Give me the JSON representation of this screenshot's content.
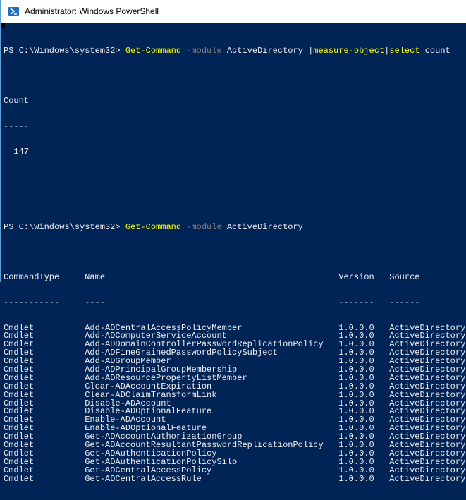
{
  "window": {
    "title": "Administrator: Windows PowerShell"
  },
  "console": {
    "cmd1": {
      "prompt": "PS C:\\Windows\\system32> ",
      "cmd": "Get-Command",
      "param": " -module",
      "arg": " ActiveDirectory ",
      "pipe1": "|",
      "cmd2": "measure-object",
      "pipe2": "|",
      "cmd3": "select",
      "arg2": " count"
    },
    "result1": {
      "header": "Count",
      "dash": "-----",
      "value": "  147"
    },
    "cmd2": {
      "prompt": "PS C:\\Windows\\system32> ",
      "cmd": "Get-Command",
      "param": " -module",
      "arg": " ActiveDirectory"
    },
    "table": {
      "headers": [
        "CommandType",
        "Name",
        "Version",
        "Source"
      ],
      "dashes": [
        "-----------",
        "----",
        "-------",
        "------"
      ],
      "rows": [
        [
          "Cmdlet",
          "Add-ADCentralAccessPolicyMember",
          "1.0.0.0",
          "ActiveDirectory"
        ],
        [
          "Cmdlet",
          "Add-ADComputerServiceAccount",
          "1.0.0.0",
          "ActiveDirectory"
        ],
        [
          "Cmdlet",
          "Add-ADDomainControllerPasswordReplicationPolicy",
          "1.0.0.0",
          "ActiveDirectory"
        ],
        [
          "Cmdlet",
          "Add-ADFineGrainedPasswordPolicySubject",
          "1.0.0.0",
          "ActiveDirectory"
        ],
        [
          "Cmdlet",
          "Add-ADGroupMember",
          "1.0.0.0",
          "ActiveDirectory"
        ],
        [
          "Cmdlet",
          "Add-ADPrincipalGroupMembership",
          "1.0.0.0",
          "ActiveDirectory"
        ],
        [
          "Cmdlet",
          "Add-ADResourcePropertyListMember",
          "1.0.0.0",
          "ActiveDirectory"
        ],
        [
          "Cmdlet",
          "Clear-ADAccountExpiration",
          "1.0.0.0",
          "ActiveDirectory"
        ],
        [
          "Cmdlet",
          "Clear-ADClaimTransformLink",
          "1.0.0.0",
          "ActiveDirectory"
        ],
        [
          "Cmdlet",
          "Disable-ADAccount",
          "1.0.0.0",
          "ActiveDirectory"
        ],
        [
          "Cmdlet",
          "Disable-ADOptionalFeature",
          "1.0.0.0",
          "ActiveDirectory"
        ],
        [
          "Cmdlet",
          "Enable-ADAccount",
          "1.0.0.0",
          "ActiveDirectory"
        ],
        [
          "Cmdlet",
          "Enable-ADOptionalFeature",
          "1.0.0.0",
          "ActiveDirectory"
        ],
        [
          "Cmdlet",
          "Get-ADAccountAuthorizationGroup",
          "1.0.0.0",
          "ActiveDirectory"
        ],
        [
          "Cmdlet",
          "Get-ADAccountResultantPasswordReplicationPolicy",
          "1.0.0.0",
          "ActiveDirectory"
        ],
        [
          "Cmdlet",
          "Get-ADAuthenticationPolicy",
          "1.0.0.0",
          "ActiveDirectory"
        ],
        [
          "Cmdlet",
          "Get-ADAuthenticationPolicySilo",
          "1.0.0.0",
          "ActiveDirectory"
        ],
        [
          "Cmdlet",
          "Get-ADCentralAccessPolicy",
          "1.0.0.0",
          "ActiveDirectory"
        ],
        [
          "Cmdlet",
          "Get-ADCentralAccessRule",
          "1.0.0.0",
          "ActiveDirectory"
        ]
      ]
    }
  },
  "colors": {
    "background": "#012456",
    "text": "#eeedf0",
    "command": "#ffff00",
    "parameter": "#808080"
  }
}
